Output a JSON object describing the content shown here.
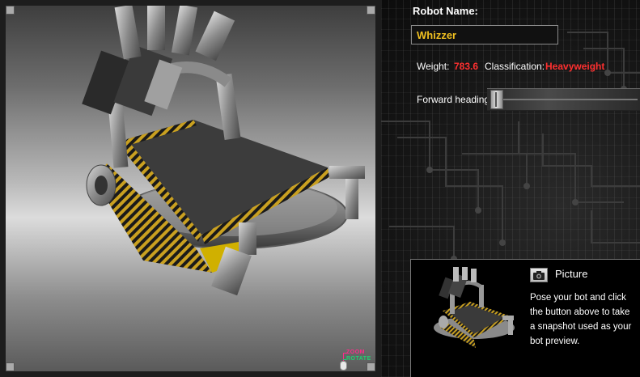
{
  "viewport": {
    "zoom_label": "ZOOM",
    "rotate_label": "ROTATE"
  },
  "panel": {
    "robot_name_label": "Robot Name:",
    "robot_name_value": "Whizzer",
    "weight_label": "Weight:",
    "weight_value": "783.6",
    "classification_label": "Classification:",
    "classification_value": "Heavyweight",
    "heading_label": "Forward heading:",
    "heading_value": 0.0,
    "picture_label": "Picture",
    "picture_description": "Pose your bot and click the button above to take a snapshot used as your bot preview."
  },
  "colors": {
    "name_text": "#f0c020",
    "stat_value": "#ff3030",
    "zoom": "#ff2a8a",
    "rotate": "#20d070"
  },
  "icons": {
    "camera": "camera-icon",
    "mouse": "mouse-icon"
  }
}
